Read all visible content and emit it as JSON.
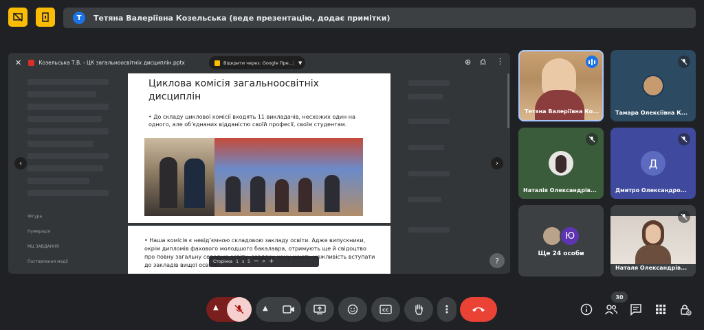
{
  "banner": {
    "avatar_letter": "Т",
    "text": "Тетяна Валеріївна Козельська (веде презентацію, додає примітки)"
  },
  "viewer": {
    "file_title": "Козельська Т.В. - ЦК загальноосвітніх дисциплін.pptx",
    "open_with": "Відкрити через: Google Пре...",
    "sidebar_ghost": [
      "Фігура",
      "Нумерація",
      "МЦ ЗАВДАННЯ",
      "Поставлення медії"
    ],
    "slide1": {
      "title": "Циклова комісія загальноосвітніх дисциплін",
      "bullet": "До складу циклової комісії входять 11 викладачів, несхожих один на одного, але об’єднаних відданістю своїй професії, своїм студентам."
    },
    "slide2": {
      "bullet": "Наша комісія є невід’ємною складовою закладу освіти. Адже випускники, окрім дипломів фахового молодшого бакалавра, отримують ще й свідоцтво про повну загальну середню освіту, завдяки чому мають можливість вступати до закладів вищої освіти."
    },
    "page_toolbar": {
      "label": "Сторінка",
      "current": "1",
      "sep": "з",
      "total": "5"
    }
  },
  "participants": [
    {
      "name": "Тетяна Валеріївна Ко...",
      "speaking": true
    },
    {
      "name": "Тамара Олексіївна К...",
      "muted": true
    },
    {
      "name": "Наталія Олександрів...",
      "muted": true
    },
    {
      "name": "Дмитро Олександро...",
      "muted": true,
      "letter": "Д"
    },
    {
      "name": "Наталя Олександрів...",
      "muted": true
    }
  ],
  "more_tile": {
    "label": "Ще 24 особи",
    "letter": "Ю"
  },
  "controls": {
    "participant_count": "30"
  },
  "colors": {
    "accent_yellow": "#fbbc04",
    "leave_red": "#ea4335",
    "mic_off_bg": "#f6cfcf",
    "tile_bg": "#3c4043",
    "purple_avatar": "#5e35b1",
    "blue_tile": "#3f4a9e"
  }
}
